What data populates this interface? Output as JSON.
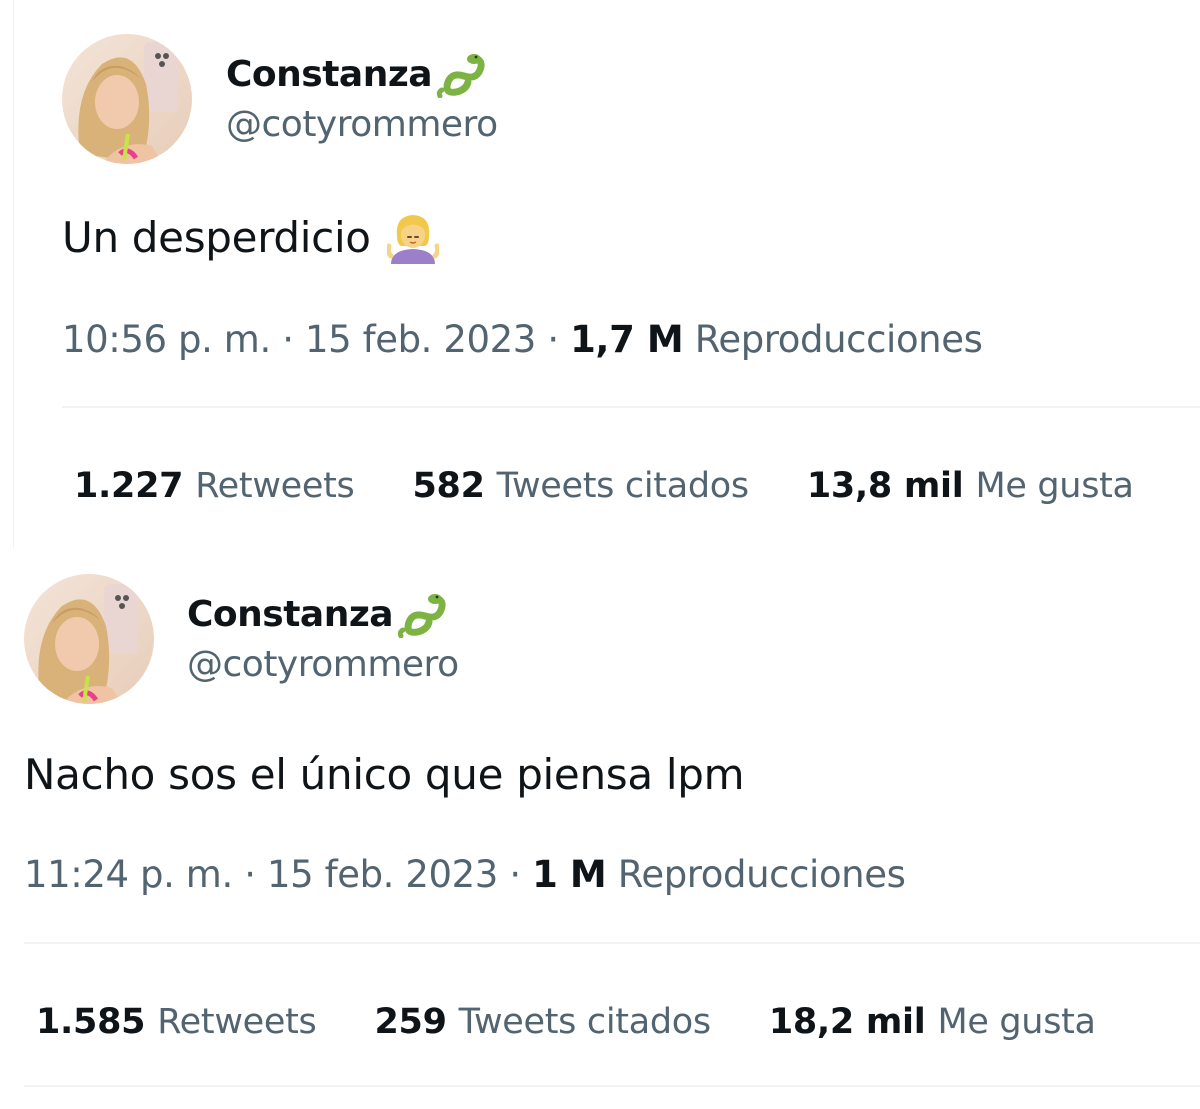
{
  "tweets": [
    {
      "author": {
        "display_name": "Constanza",
        "handle": "@cotyrommero",
        "name_emoji": "snake-icon"
      },
      "text": "Un desperdicio",
      "text_emoji": "woman-shrugging-icon",
      "time": "10:56 p. m.",
      "separator": "·",
      "date": "15 feb. 2023",
      "views_count": "1,7 M",
      "views_label": "Reproducciones",
      "stats": {
        "retweets_count": "1.227",
        "retweets_label": "Retweets",
        "quotes_count": "582",
        "quotes_label": "Tweets citados",
        "likes_count": "13,8 mil",
        "likes_label": "Me gusta"
      }
    },
    {
      "author": {
        "display_name": "Constanza",
        "handle": "@cotyrommero",
        "name_emoji": "snake-icon"
      },
      "text": "Nacho sos el único que piensa lpm",
      "time": "11:24 p. m.",
      "separator": "·",
      "date": "15 feb. 2023",
      "views_count": "1 M",
      "views_label": "Reproducciones",
      "stats": {
        "retweets_count": "1.585",
        "retweets_label": "Retweets",
        "quotes_count": "259",
        "quotes_label": "Tweets citados",
        "likes_count": "18,2 mil",
        "likes_label": "Me gusta"
      }
    }
  ],
  "colors": {
    "text_primary": "#0f1419",
    "text_secondary": "#536471",
    "divider": "#eff3f4",
    "snake_green": "#7cb342"
  }
}
